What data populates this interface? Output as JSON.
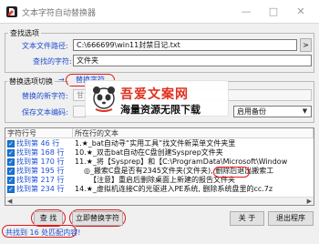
{
  "window": {
    "title": "文本字符自动替换器",
    "controls": [
      "—",
      "□",
      "✕"
    ]
  },
  "find_group": {
    "title": "查找选项",
    "path_label": "文本文件路径:",
    "path_value": "C:\\666699\\win11封禁日记.txt",
    "browse_label": ">",
    "find_label": "查找的字符:",
    "find_value": "文件夹"
  },
  "replace_group": {
    "title": "替换选项切换",
    "arrow": "→",
    "replace_button": "替换字符",
    "new_text_label": "替换的新字符:",
    "new_text_value": "甘肃卡屏叶酐工作室",
    "encoding_label": "保存文本编码:",
    "backup_value": "启用备份"
  },
  "results": {
    "col1": "字符行号",
    "col2": "所在行的文本",
    "rows": [
      {
        "name": "找到第 46 行",
        "text": "1.★_bat自动寻“实用工具”找文件新菜单文件夹里"
      },
      {
        "name": "找到第 168 行",
        "text": "10.★_双击bat自动在C盘创建Sysprep文件夹"
      },
      {
        "name": "找到第 170 行",
        "text": "11.★_将【Sysprep】和【C:\\ProgramData\\Microsoft\\Window"
      },
      {
        "name": "找到第 195 行",
        "text": "◎_搬索C盘是否有2345文件夹(文件夹), 删除后退出搬索工"
      },
      {
        "name": "找到第 217 行",
        "text": "【注意】重启后删除桌面上新建的报告文件夹"
      },
      {
        "name": "找到第 234 行",
        "text": "14.★_虚拟机连接C的光驱进入PE系统, 删除系统盘里的cc.7z"
      }
    ]
  },
  "watermark": {
    "site_name": "吾爱文案网",
    "slogan": "海量资源无限下载"
  },
  "buttons": {
    "find": "查 找",
    "replace_now": "立即替换字符",
    "about": "关 于",
    "exit": "退出程序"
  },
  "status_text": "共找到 16 处匹配内容!"
}
